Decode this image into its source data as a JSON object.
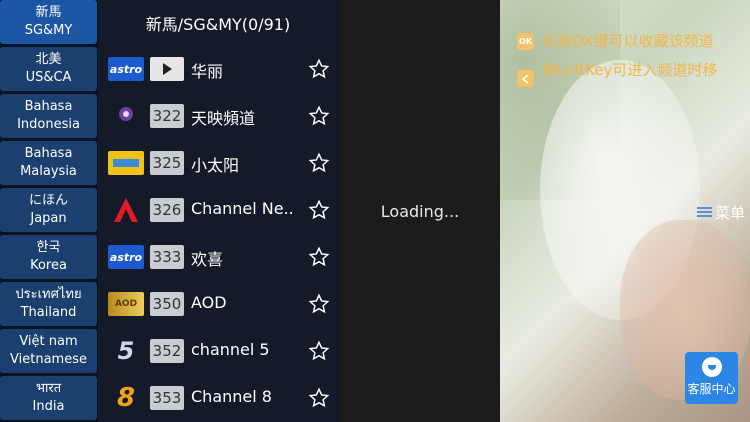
{
  "sidebar": {
    "regions": [
      {
        "line1": "新馬",
        "line2": "SG&MY",
        "active": true
      },
      {
        "line1": "北美",
        "line2": "US&CA"
      },
      {
        "line1": "Bahasa",
        "line2": "Indonesia"
      },
      {
        "line1": "Bahasa",
        "line2": "Malaysia"
      },
      {
        "line1": "にほん",
        "line2": "Japan"
      },
      {
        "line1": "한국",
        "line2": "Korea"
      },
      {
        "line1": "ประเทศไทย",
        "line2": "Thailand"
      },
      {
        "line1": "Việt nam",
        "line2": "Vietnamese"
      },
      {
        "line1": "भारत",
        "line2": "India"
      }
    ]
  },
  "channel_list": {
    "title": "新馬/SG&MY(0/91)",
    "channels": [
      {
        "logo": "astro",
        "number": "",
        "name": "华丽"
      },
      {
        "logo": "tianying-icon",
        "number": "322",
        "name": "天映頻道"
      },
      {
        "logo": "xiaotaiyang-icon",
        "number": "325",
        "name": "小太阳"
      },
      {
        "logo": "channel-news-asia-icon",
        "number": "326",
        "name": "Channel Ne.."
      },
      {
        "logo": "astro",
        "number": "333",
        "name": "欢喜"
      },
      {
        "logo": "astro-aod-icon",
        "number": "350",
        "name": "AOD"
      },
      {
        "logo": "channel-5-icon",
        "number": "352",
        "name": "channel 5"
      },
      {
        "logo": "channel-8-icon",
        "number": "353",
        "name": "Channel 8"
      }
    ]
  },
  "player": {
    "status": "Loading..."
  },
  "overlay": {
    "hint_ok_icon": "OK",
    "hint_ok_text": "长按OK键可以收藏该频道",
    "hint_left_text": "按LeftKey可进入频道时移",
    "menu_label": "菜单",
    "support_label": "客服中心"
  },
  "colors": {
    "accent": "#1e56a6",
    "hint": "#f2b54a",
    "support": "#2b86e6"
  }
}
